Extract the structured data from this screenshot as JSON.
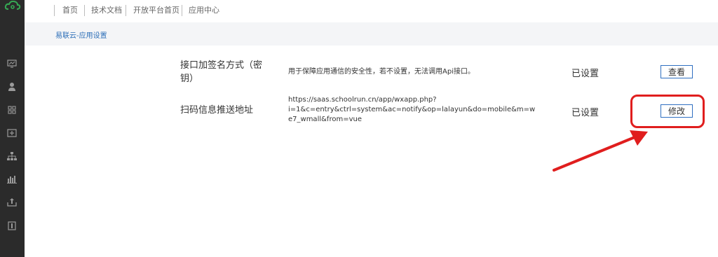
{
  "nav": {
    "items": [
      "首页",
      "技术文档",
      "开放平台首页",
      "应用中心"
    ]
  },
  "breadcrumb": "易联云-应用设置",
  "settings": [
    {
      "label_line1": "接口加签名方式（密",
      "label_line2": "钥）",
      "desc_lines": [
        "用于保障应用通信的安全性，若不设置，无法调用Api接口。"
      ],
      "status": "已设置",
      "button": "查看"
    },
    {
      "label_line1": "扫码信息推送地址",
      "label_line2": "",
      "desc_lines": [
        "https://saas.schoolrun.cn/app/wxapp.php?",
        "i=1&c=entry&ctrl=system&ac=notify&op=lalayun&do=mobile&m=w",
        "e7_wmall&from=vue"
      ],
      "status": "已设置",
      "button": "修改"
    }
  ],
  "sidebar_icons": [
    "monitor-icon",
    "user-icon",
    "grid-icon",
    "add-box-icon",
    "network-icon",
    "bar-chart-icon",
    "upload-icon",
    "info-box-icon"
  ],
  "colors": {
    "sidebar": "#2b2b2b",
    "logo": "#35a853",
    "link": "#2d6fb8",
    "button_border": "#2f6fc1",
    "highlight": "#e01e1e"
  }
}
